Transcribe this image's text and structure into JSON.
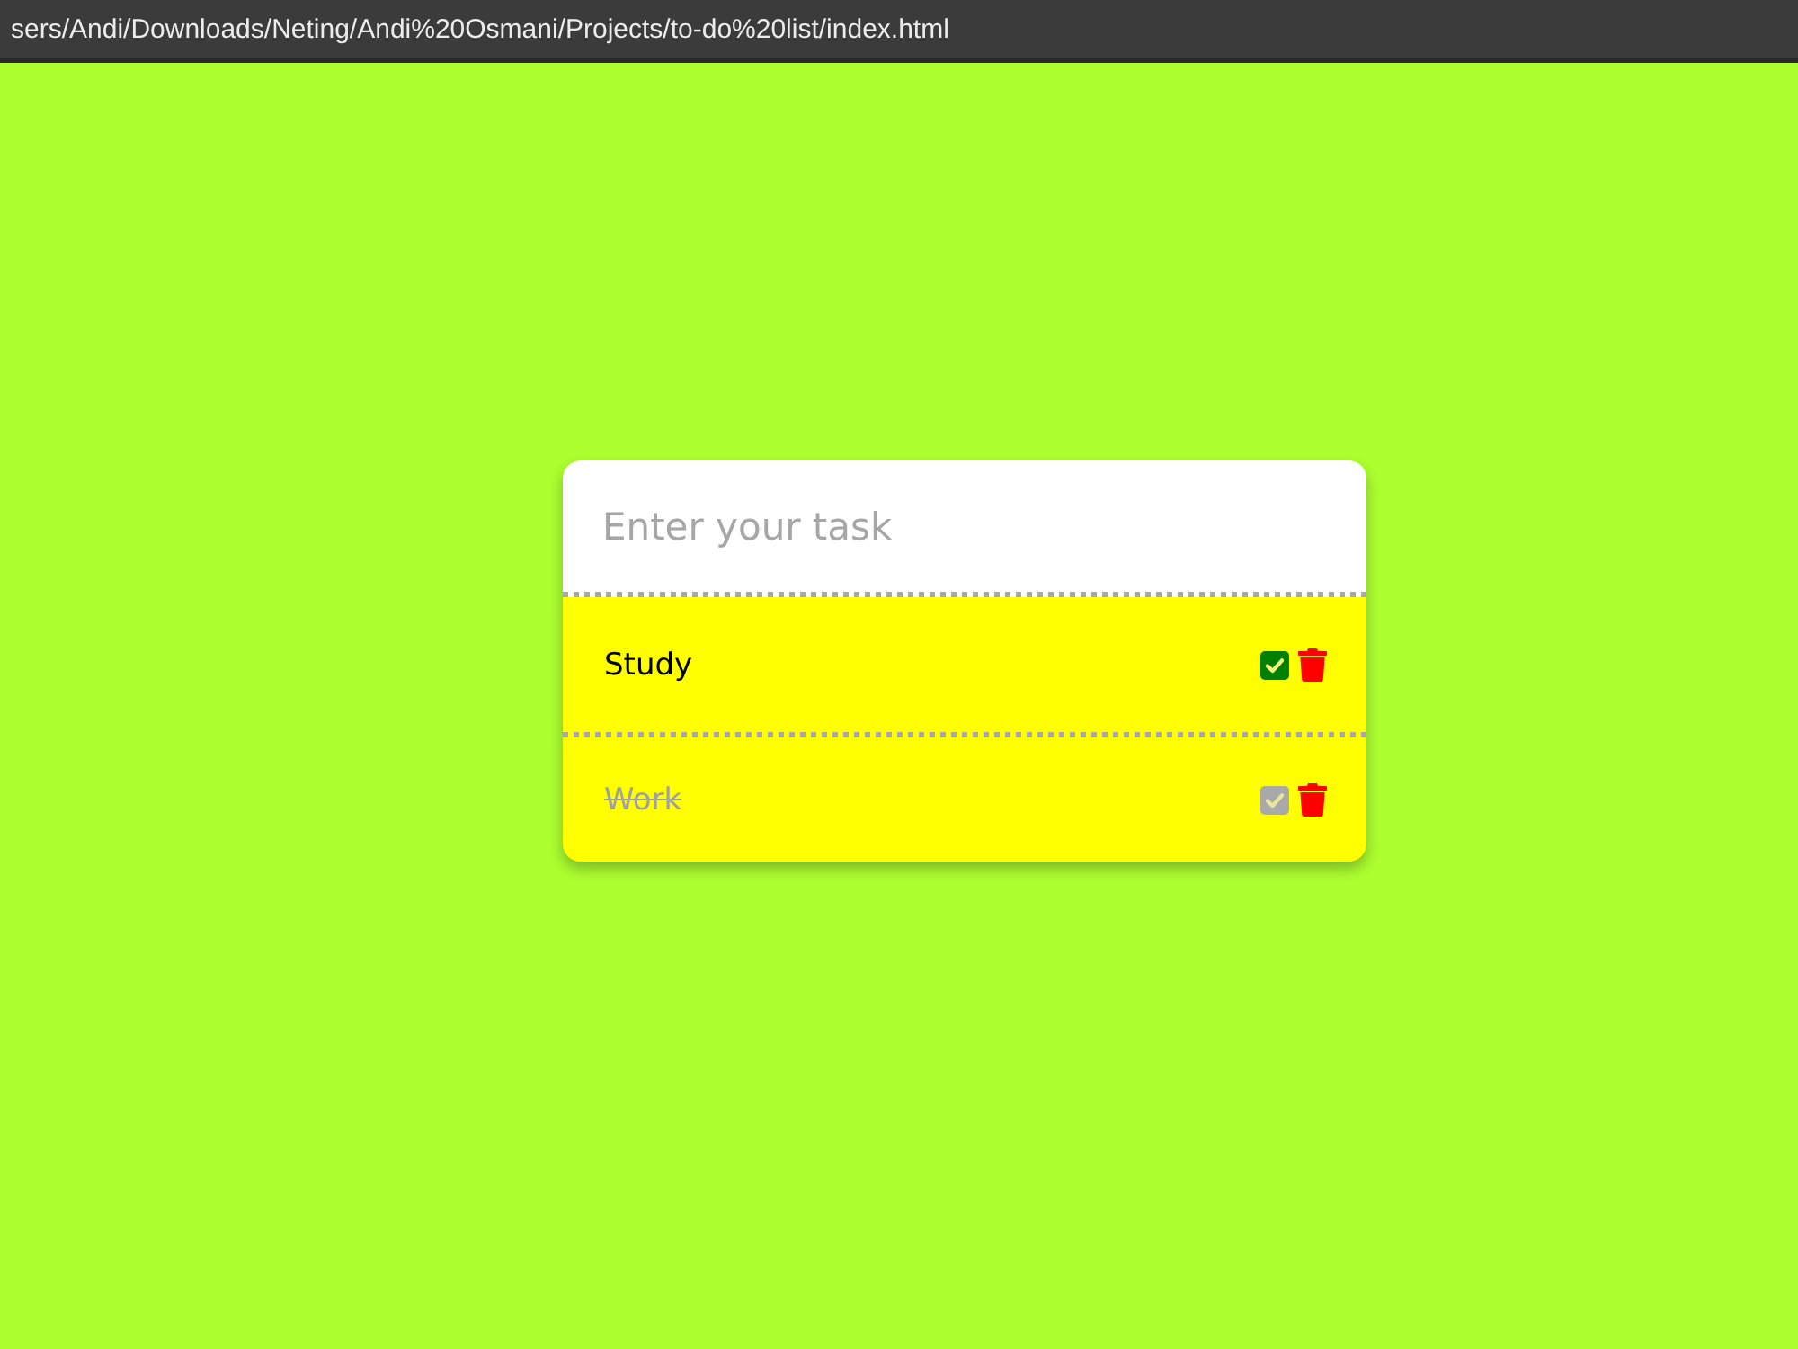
{
  "address_bar": {
    "url": "sers/Andi/Downloads/Neting/Andi%20Osmani/Projects/to-do%20list/index.html"
  },
  "task_input": {
    "placeholder": "Enter your task"
  },
  "tasks": [
    {
      "text": "Study",
      "done": false
    },
    {
      "text": "Work",
      "done": true
    }
  ]
}
